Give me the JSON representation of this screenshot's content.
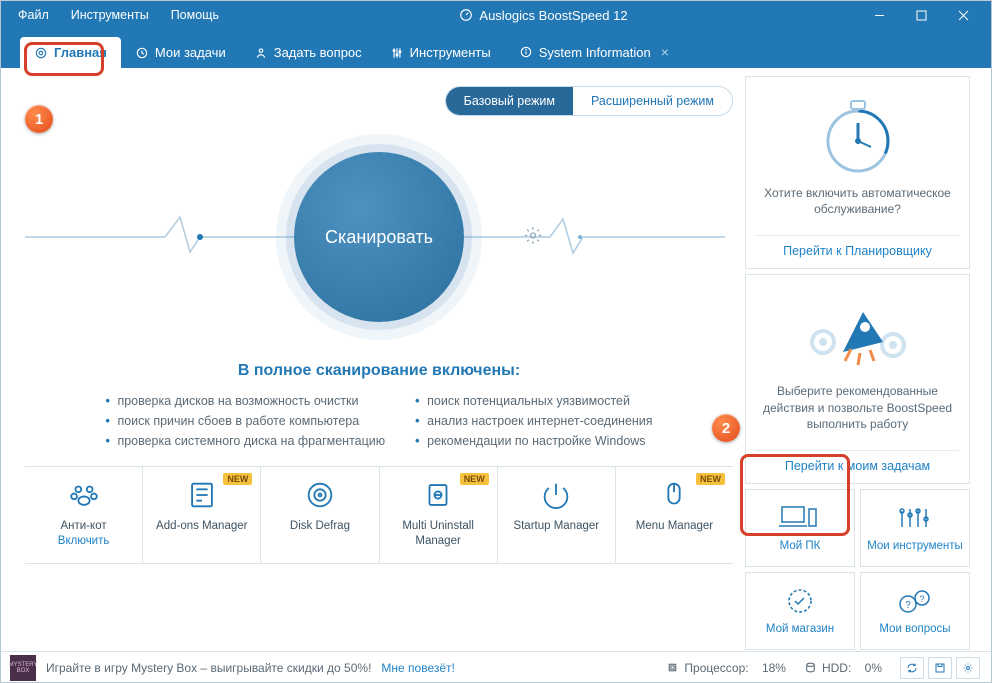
{
  "titlebar": {
    "menu": {
      "file": "Файл",
      "tools": "Инструменты",
      "help": "Помощь"
    },
    "app_title": "Auslogics BoostSpeed 12"
  },
  "tabs": {
    "main": "Главная",
    "my_tasks": "Мои задачи",
    "ask_question": "Задать вопрос",
    "tools": "Инструменты",
    "system_info": "System Information"
  },
  "mode": {
    "basic": "Базовый режим",
    "advanced": "Расширенный режим"
  },
  "scan": {
    "button": "Сканировать"
  },
  "includes": {
    "title": "В полное сканирование включены:",
    "left": [
      "проверка дисков на возможность очистки",
      "поиск причин сбоев в работе компьютера",
      "проверка системного диска на фрагментацию"
    ],
    "right": [
      "поиск потенциальных уязвимостей",
      "анализ настроек интернет-соединения",
      "рекомендации по настройке Windows"
    ]
  },
  "tools_row": [
    {
      "name": "Анти-кот",
      "sub": "Включить",
      "new": false
    },
    {
      "name": "Add-ons Manager",
      "sub": "",
      "new": true
    },
    {
      "name": "Disk Defrag",
      "sub": "",
      "new": false
    },
    {
      "name": "Multi Uninstall Manager",
      "sub": "",
      "new": true
    },
    {
      "name": "Startup Manager",
      "sub": "",
      "new": false
    },
    {
      "name": "Menu Manager",
      "sub": "",
      "new": true
    }
  ],
  "new_badge": "NEW",
  "right_panel": {
    "card1_text": "Хотите включить автоматическое обслуживание?",
    "card1_link": "Перейти к Планировщику",
    "card2_text": "Выберите рекомендованные действия и позвольте BoostSpeed выполнить работу",
    "card2_link": "Перейти к моим задачам",
    "tiles": {
      "my_pc": "Мой ПК",
      "my_tools": "Мои инструменты",
      "my_store": "Мой магазин",
      "my_questions": "Мои вопросы"
    }
  },
  "statusbar": {
    "mystery_label": "MYSTERY BOX",
    "promo": "Играйте в игру Mystery Box – выигрывайте скидки до 50%!",
    "promo_link": "Мне повезёт!",
    "cpu_label": "Процессор:",
    "cpu_value": "18%",
    "hdd_label": "HDD:",
    "hdd_value": "0%"
  },
  "callouts": {
    "one": "1",
    "two": "2"
  }
}
